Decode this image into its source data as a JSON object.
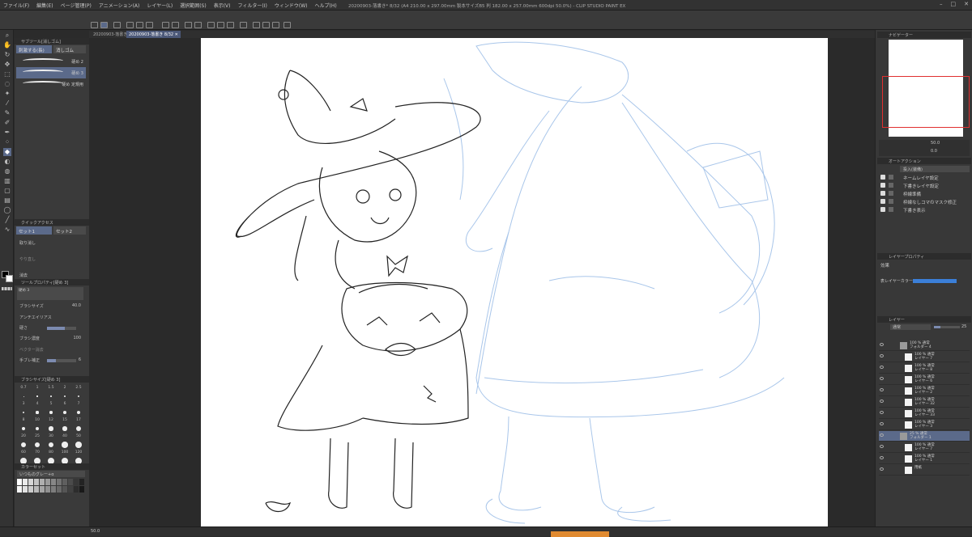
{
  "app": {
    "title": "20200903-落書き* 8/32 (A4 210.00 x 297.00mm 製本サイズB5 判 182.00 x 257.00mm 600dpi 50.0%) - CLIP STUDIO PAINT EX",
    "menus": [
      "ファイル(F)",
      "編集(E)",
      "ページ管理(P)",
      "アニメーション(A)",
      "レイヤー(L)",
      "選択範囲(S)",
      "表示(V)",
      "フィルター(I)",
      "ウィンドウ(W)",
      "ヘルプ(H)"
    ]
  },
  "tabs": [
    {
      "label": "20200903-落書き"
    },
    {
      "label": "20200903-落書き 8/32"
    }
  ],
  "subtool": {
    "header": "サブツール[消しゴム]",
    "tab_active": "刺激する(長)",
    "tab_other": "消しゴム",
    "brushes": [
      {
        "label": "硬め 2"
      },
      {
        "label": "硬め 3"
      },
      {
        "label": "硬め 定規用"
      }
    ]
  },
  "quickaccess": {
    "header": "クイックアクセス",
    "set1": "セット1",
    "set2": "セット2",
    "item1": "取り消し",
    "item2": "やり直し",
    "item3": "消去"
  },
  "toolprops": {
    "header": "ツールプロパティ[硬め 3]",
    "preset": "硬め 3",
    "brush_size_label": "ブラシサイズ",
    "brush_size_value": "40.0",
    "antialias_label": "アンチエイリアス",
    "hardness_label": "硬さ",
    "density_label": "ブラシ濃度",
    "density_value": "100",
    "vector_label": "ベクター消去",
    "stabilize_label": "手ブレ補正",
    "stabilize_value": "6"
  },
  "brushsize": {
    "header": "ブラシサイズ[硬め 3]",
    "sizes": [
      "0.7",
      "1",
      "1.5",
      "2",
      "2.5",
      "3",
      "4",
      "5",
      "6",
      "7",
      "8",
      "10",
      "12",
      "15",
      "17",
      "20",
      "25",
      "30",
      "40",
      "50",
      "60",
      "70",
      "80",
      "100",
      "120"
    ]
  },
  "colorset": {
    "header": "カラーセット",
    "name": "いつものグレー+α"
  },
  "navigator": {
    "header": "ナビゲーター",
    "zoom": "50.0",
    "rotate": "0.0"
  },
  "autoaction": {
    "header": "オートアクション",
    "set_name": "投入(装備)",
    "actions": [
      "ネームレイヤ設定",
      "下書きレイヤ設定",
      "枠線準備",
      "枠線なしコマのマスク修正",
      "下書き表示"
    ]
  },
  "layerprops": {
    "header": "レイヤープロパティ",
    "effect_label": "効果",
    "layer_color_label": "表レイヤーカラー",
    "layer_color": "#3b7fd8"
  },
  "layers": {
    "header": "レイヤー",
    "blend": "通常",
    "opacity": "25",
    "rows": [
      {
        "line1": "100 % 通常",
        "line2": "フォルダー 4"
      },
      {
        "line1": "100 % 通常",
        "line2": "レイヤー 7"
      },
      {
        "line1": "100 % 通常",
        "line2": "レイヤー 8"
      },
      {
        "line1": "100 % 通常",
        "line2": "レイヤー 6"
      },
      {
        "line1": "100 % 通常",
        "line2": "レイヤー 2"
      },
      {
        "line1": "100 % 通常",
        "line2": "レイヤー 32"
      },
      {
        "line1": "100 % 通常",
        "line2": "レイヤー 33"
      },
      {
        "line1": "100 % 通常",
        "line2": "レイヤー 3"
      },
      {
        "line1": "25 % 通常",
        "line2": "フォルダー 1"
      },
      {
        "line1": "100 % 通常",
        "line2": "レイヤー 7"
      },
      {
        "line1": "100 % 通常",
        "line2": "レイヤー 1"
      },
      {
        "line1": "",
        "line2": "用紙"
      }
    ]
  },
  "status": {
    "zoom": "50.0"
  }
}
